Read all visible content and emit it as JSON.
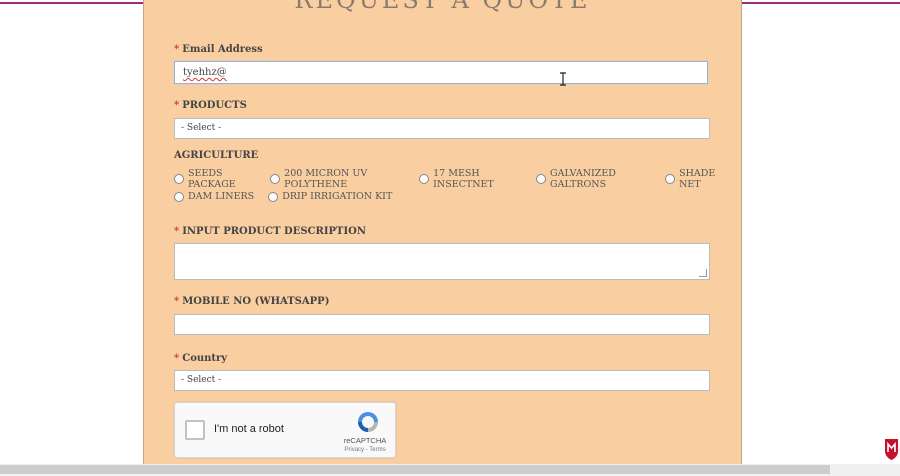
{
  "form": {
    "title": "REQUEST A QUOTE",
    "required_mark": "*",
    "email": {
      "label": "Email Address",
      "value": "tyehhz@"
    },
    "products": {
      "label": "PRODUCTS",
      "selected": "- Select -"
    },
    "agriculture": {
      "heading": "AGRICULTURE",
      "options": [
        "SEEDS PACKAGE",
        "200 MICRON UV POLYTHENE",
        "17 MESH INSECTNET",
        "GALVANIZED GALTRONS",
        "SHADE NET",
        "DAM LINERS",
        "DRIP IRRIGATION KIT"
      ]
    },
    "description": {
      "label": "INPUT PRODUCT DESCRIPTION",
      "value": ""
    },
    "mobile": {
      "label": "MOBILE NO (WHATSAPP)",
      "value": ""
    },
    "country": {
      "label": "Country",
      "selected": "- Select -"
    }
  },
  "recaptcha": {
    "label": "I'm not a robot",
    "brand": "reCAPTCHA",
    "terms": "Privacy - Terms"
  },
  "colors": {
    "panel": "#f9cfa2",
    "top_line": "#9a2a86",
    "required": "#dd3333"
  }
}
